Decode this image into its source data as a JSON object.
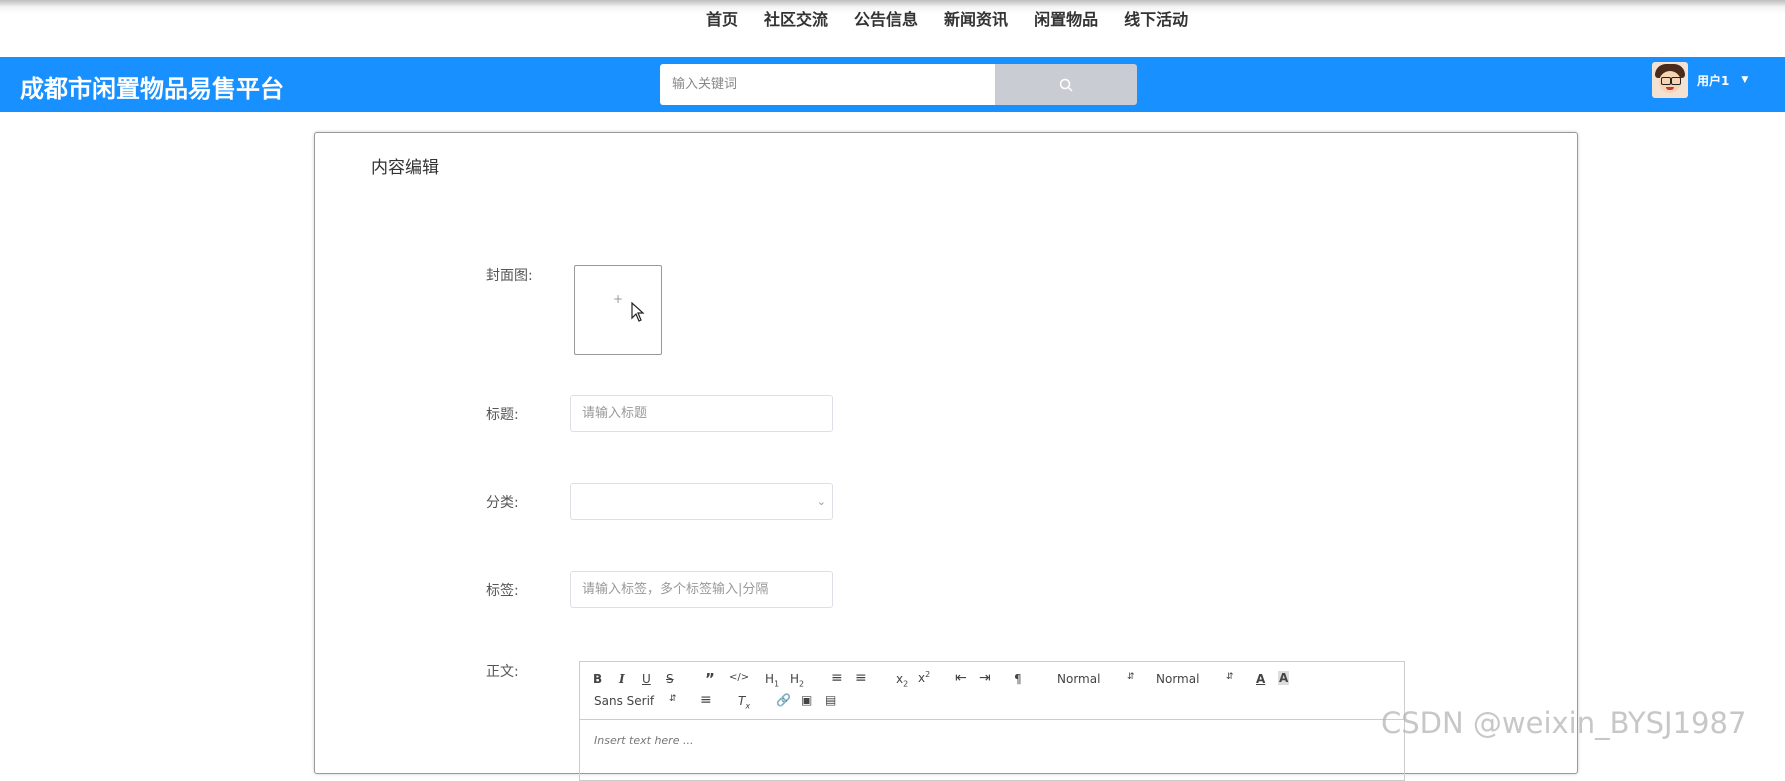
{
  "nav": {
    "items": [
      "首页",
      "社区交流",
      "公告信息",
      "新闻资讯",
      "闲置物品",
      "线下活动"
    ]
  },
  "header": {
    "brand": "成都市闲置物品易售平台",
    "search_placeholder": "输入关键词",
    "user_name": "用户1"
  },
  "form": {
    "title": "内容编辑",
    "cover_label": "封面图:",
    "cover_plus": "+",
    "title_label": "标题:",
    "title_placeholder": "请输入标题",
    "category_label": "分类:",
    "tags_label": "标签:",
    "tags_placeholder": "请输入标签，多个标签输入|分隔",
    "content_label": "正文:"
  },
  "editor": {
    "header_select": "Normal",
    "size_select": "Normal",
    "font_select": "Sans Serif",
    "placeholder": "Insert text here ..."
  },
  "watermark": "CSDN @weixin_BYSJ1987",
  "colors": {
    "header": "#1890ff",
    "search_button": "#c9cdd3"
  }
}
